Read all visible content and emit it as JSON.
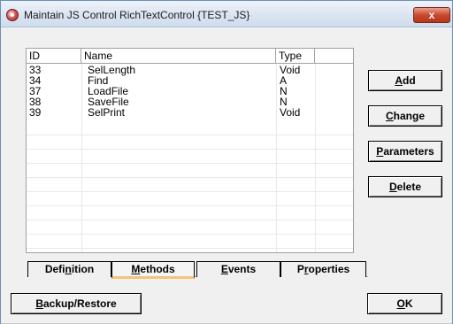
{
  "window": {
    "title": "Maintain JS Control RichTextControl {TEST_JS}",
    "close_label": "x"
  },
  "list": {
    "columns": [
      "ID",
      "Name",
      "Type"
    ],
    "rows": [
      {
        "id": "33",
        "name": "SelLength",
        "type": "Void"
      },
      {
        "id": "34",
        "name": "Find",
        "type": "A"
      },
      {
        "id": "37",
        "name": "LoadFile",
        "type": "N"
      },
      {
        "id": "38",
        "name": "SaveFile",
        "type": "N"
      },
      {
        "id": "39",
        "name": "SelPrint",
        "type": "Void"
      }
    ]
  },
  "buttons": {
    "add": {
      "mnemonic": "A",
      "rest": "dd"
    },
    "change": {
      "mnemonic": "C",
      "rest": "hange"
    },
    "parameters": {
      "mnemonic": "P",
      "rest": "arameters"
    },
    "delete": {
      "mnemonic": "D",
      "rest": "elete"
    },
    "backup": {
      "mnemonic": "B",
      "rest": "ackup/Restore"
    },
    "ok": {
      "mnemonic": "O",
      "rest": "K"
    }
  },
  "tabs": [
    {
      "pre": "Defi",
      "mnemonic": "n",
      "post": "ition",
      "active": false
    },
    {
      "pre": "",
      "mnemonic": "M",
      "post": "ethods",
      "active": true
    },
    {
      "pre": "",
      "mnemonic": "E",
      "post": "vents",
      "active": false
    },
    {
      "pre": "P",
      "mnemonic": "r",
      "post": "operties",
      "active": false
    }
  ],
  "colors": {
    "active_tab_accent": "#f5c37a",
    "close_button": "#c9492d"
  }
}
